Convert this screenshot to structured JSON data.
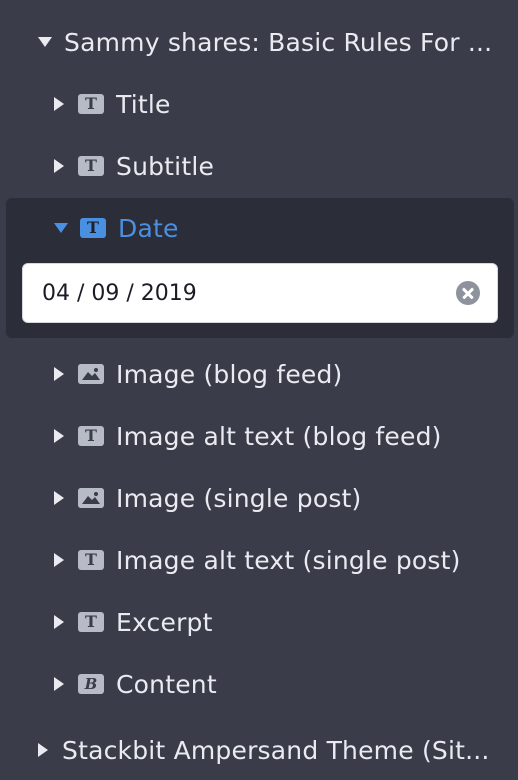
{
  "tree": {
    "root_label": "Sammy shares: Basic Rules For ...",
    "fields": [
      {
        "label": "Title",
        "icon": "text-type-icon",
        "glyph": "T"
      },
      {
        "label": "Subtitle",
        "icon": "text-type-icon",
        "glyph": "T"
      },
      {
        "label": "Date",
        "icon": "text-type-icon",
        "glyph": "T",
        "expanded": true
      },
      {
        "label": "Image (blog feed)",
        "icon": "image-type-icon"
      },
      {
        "label": "Image alt text (blog feed)",
        "icon": "text-type-icon",
        "glyph": "T"
      },
      {
        "label": "Image (single post)",
        "icon": "image-type-icon"
      },
      {
        "label": "Image alt text (single post)",
        "icon": "text-type-icon",
        "glyph": "T"
      },
      {
        "label": "Excerpt",
        "icon": "text-type-icon",
        "glyph": "T"
      },
      {
        "label": "Content",
        "icon": "markdown-type-icon",
        "glyph": "B"
      }
    ],
    "sibling_root_label": "Stackbit Ampersand Theme (Sit..."
  },
  "date_field": {
    "value": "04 / 09 / 2019"
  },
  "colors": {
    "background": "#3a3c49",
    "selected_background": "#2b2d38",
    "accent": "#4a90e2",
    "text": "#e9ebf0"
  }
}
